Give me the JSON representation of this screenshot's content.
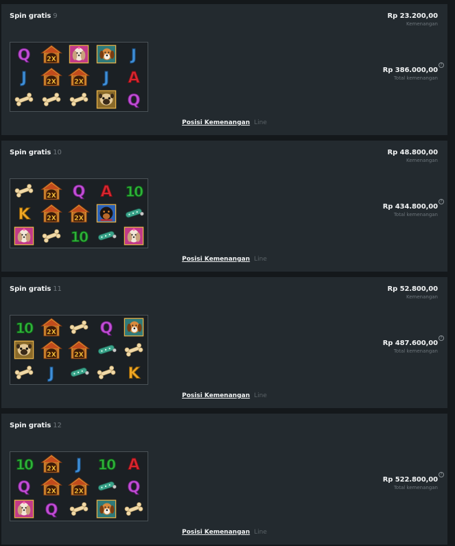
{
  "labels": {
    "spin": "Spin gratis",
    "win_label": "Kemenangan",
    "total_label": "Total kemenangan",
    "positions_link": "Posisi Kemenangan",
    "line_link": "Line",
    "help": "?"
  },
  "spins": [
    {
      "number": "9",
      "win": "Rp 23.200,00",
      "total": "Rp 386.000,00",
      "reels": [
        [
          "q",
          "house2x",
          "dog-shihtzu",
          "dog-beagle",
          "j"
        ],
        [
          "j",
          "house2x",
          "house2x",
          "j",
          "a"
        ],
        [
          "bone",
          "bone",
          "bone",
          "dog-pug",
          "q"
        ]
      ]
    },
    {
      "number": "10",
      "win": "Rp 48.800,00",
      "total": "Rp 434.800,00",
      "reels": [
        [
          "bone",
          "house2x",
          "q",
          "a",
          "ten"
        ],
        [
          "k",
          "house2x",
          "house2x",
          "dog-rottweiler",
          "collar"
        ],
        [
          "dog-shihtzu",
          "bone",
          "ten",
          "collar",
          "dog-shihtzu"
        ]
      ]
    },
    {
      "number": "11",
      "win": "Rp 52.800,00",
      "total": "Rp 487.600,00",
      "reels": [
        [
          "ten",
          "house2x",
          "bone",
          "q",
          "dog-beagle"
        ],
        [
          "dog-pug",
          "house2x",
          "house2x",
          "collar",
          "bone"
        ],
        [
          "bone",
          "j",
          "collar",
          "bone",
          "k"
        ]
      ]
    },
    {
      "number": "12",
      "win": "",
      "total": "Rp 522.800,00",
      "reels": [
        [
          "ten",
          "house2x",
          "j",
          "ten",
          "a"
        ],
        [
          "q",
          "house2x",
          "house2x",
          "collar",
          "q"
        ],
        [
          "dog-shihtzu",
          "q",
          "bone",
          "dog-beagle",
          "bone"
        ]
      ]
    }
  ],
  "colors": {
    "q": "#c24fd6",
    "j": "#3f8fd8",
    "a": "#d8262f",
    "k": "#f0a825",
    "ten": "#2fb23a",
    "house": "#e7a338",
    "collar": "#3aa38a",
    "bone": "#f0d9a8"
  }
}
